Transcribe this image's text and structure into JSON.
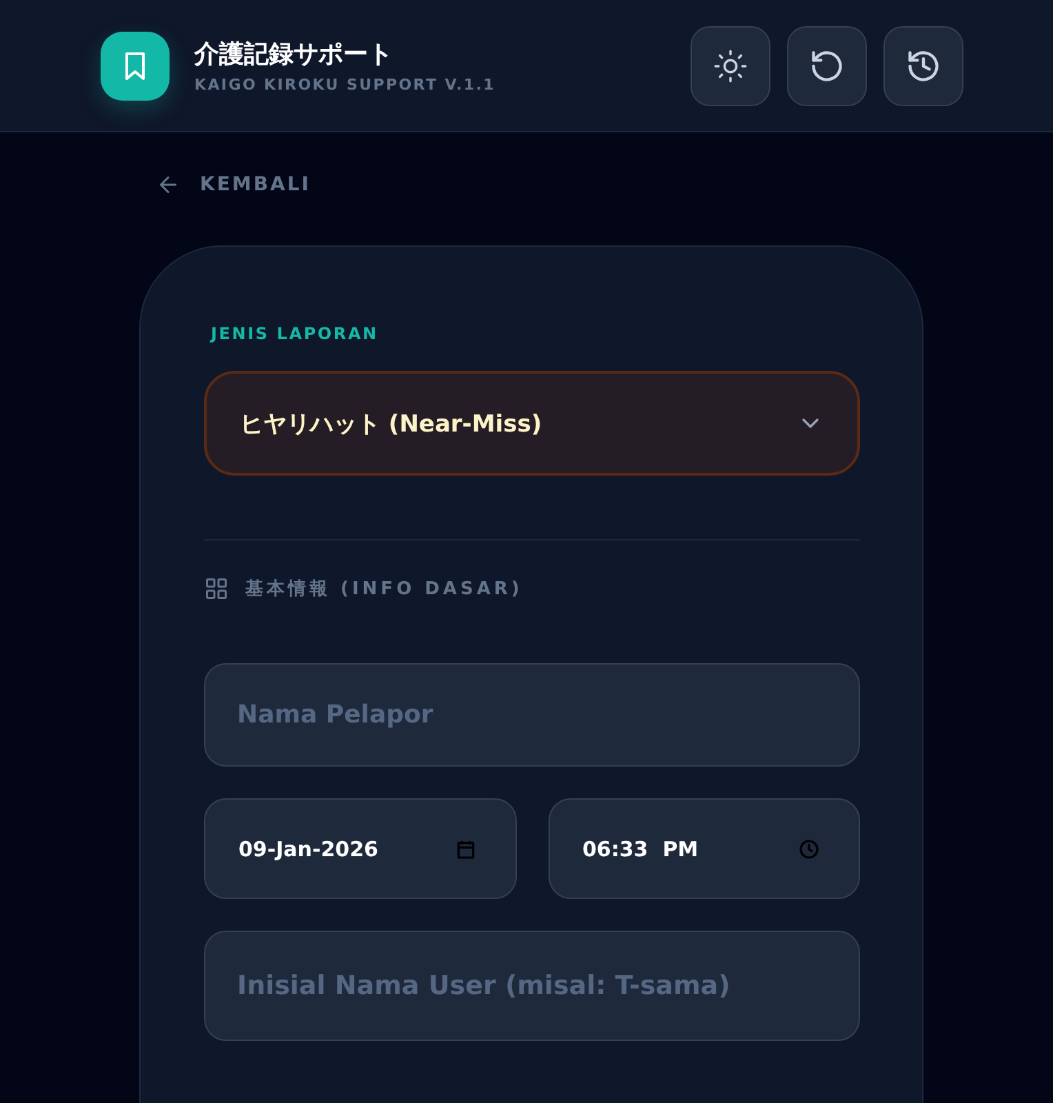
{
  "header": {
    "title": "介護記録サポート",
    "subtitle": "KAIGO KIROKU SUPPORT V.1.1",
    "buttons": [
      {
        "kind": "theme"
      },
      {
        "kind": "reset"
      },
      {
        "kind": "history"
      }
    ]
  },
  "back_link": {
    "label": "KEMBALI"
  },
  "form": {
    "report_type_label": "JENIS LAPORAN",
    "report_type_value": "ヒヤリハット (Near-Miss)",
    "section_title": "基本情報 (INFO DASAR)",
    "reporter": {
      "placeholder": "Nama Pelapor"
    },
    "date": {
      "value": "09-Jan-2026"
    },
    "time": {
      "value": "06:33  PM"
    },
    "user_initial": {
      "placeholder": "Inisial Nama User (misal: T-sama)"
    }
  }
}
